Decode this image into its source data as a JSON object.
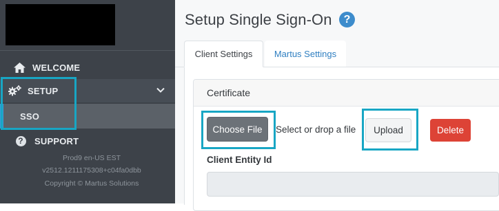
{
  "sidebar": {
    "items": [
      {
        "label": "WELCOME",
        "icon": "home-icon"
      },
      {
        "label": "SETUP",
        "icon": "gears-icon"
      },
      {
        "label": "SSO"
      },
      {
        "label": "SUPPORT",
        "icon": "help-circle-icon"
      }
    ],
    "info": {
      "env": "Prod9 en-US EST",
      "version": "v2512.1211175308+c04fa0dbb",
      "copyright": "Copyright © Martus Solutions"
    }
  },
  "main": {
    "title": "Setup Single Sign-On",
    "help_icon_glyph": "?",
    "tabs": [
      {
        "label": "Client Settings",
        "active": true
      },
      {
        "label": "Martus Settings",
        "active": false
      }
    ],
    "certificate": {
      "header": "Certificate",
      "choose_file_label": "Choose File",
      "file_placeholder": "Select or drop a file",
      "upload_label": "Upload",
      "delete_label": "Delete"
    },
    "client_entity": {
      "label": "Client Entity Id",
      "value": ""
    }
  },
  "colors": {
    "sidebar_bg": "#3d4249",
    "accent_blue": "#3a9ad9",
    "highlight": "#18a6c4",
    "delete_red": "#dd4336"
  }
}
